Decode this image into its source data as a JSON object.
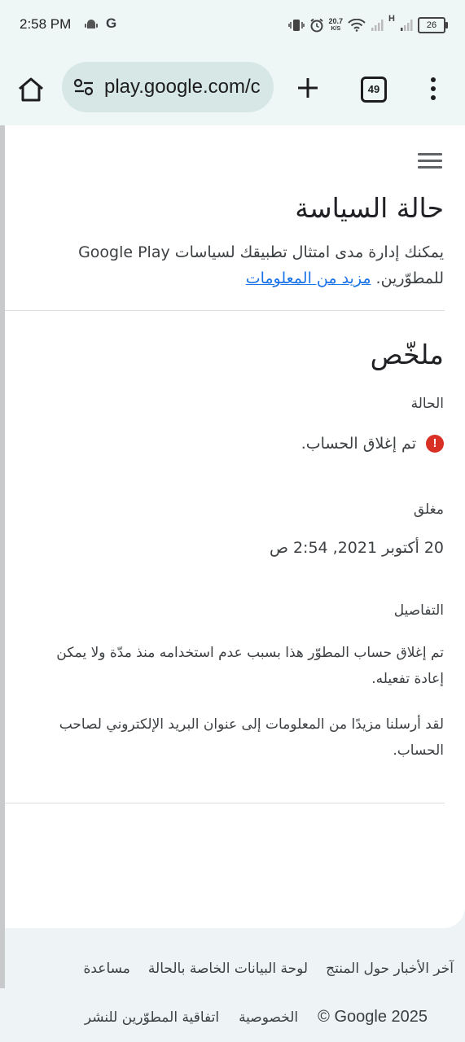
{
  "status_bar": {
    "time": "2:58 PM",
    "g_label": "G",
    "net_speed_value": "20.7",
    "net_speed_unit": "K/S",
    "signal_h": "H",
    "battery": "26"
  },
  "browser": {
    "url": "play.google.com/c",
    "tab_count": "49"
  },
  "page": {
    "title": "حالة السياسة",
    "intro_text": "يمكنك إدارة مدى امتثال تطبيقك لسياسات Google Play للمطوّرين. ",
    "learn_more": "مزيد من المعلومات",
    "summary_heading": "ملخّص",
    "status_label": "الحالة",
    "status_value": "تم إغلاق الحساب.",
    "closed_label": "مغلق",
    "closed_value": "20 أكتوبر 2021, 2:54 ص",
    "details_label": "التفاصيل",
    "details_para1": "تم إغلاق حساب المطوّر هذا بسبب عدم استخدامه منذ مدّة ولا يمكن إعادة تفعيله.",
    "details_para2": "لقد أرسلنا مزيدًا من المعلومات إلى عنوان البريد الإلكتروني لصاحب الحساب."
  },
  "footer": {
    "link_news": "آخر الأخبار حول المنتج",
    "link_status_dashboard": "لوحة البيانات الخاصة بالحالة",
    "link_help": "مساعدة",
    "copyright": "© Google 2025",
    "link_privacy": "الخصوصية",
    "link_dda": "اتفاقية المطوّرين للنشر"
  },
  "colors": {
    "accent_link": "#1a73e8",
    "error": "#d93025",
    "chrome_bg": "#eef7f6",
    "urlbar_bg": "#d6e7e5"
  },
  "icons": [
    "android-icon",
    "vibrate-icon",
    "alarm-icon",
    "wifi-icon",
    "signal-icon",
    "battery-icon",
    "home-icon",
    "site-settings-icon",
    "plus-icon",
    "tabs-icon",
    "more-vert-icon",
    "hamburger-menu-icon",
    "error-icon"
  ]
}
